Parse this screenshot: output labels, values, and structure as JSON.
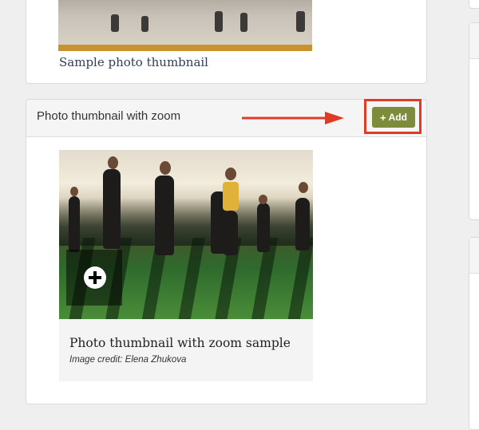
{
  "top_card": {
    "caption": "Sample photo thumbnail"
  },
  "main_card": {
    "title": "Photo thumbnail with zoom",
    "add_button": {
      "icon": "plus-icon",
      "label": "Add"
    },
    "annotation_color": "#e03b24",
    "accent_button_color": "#7d8c3a",
    "photo": {
      "zoom_icon": "zoom-plus-icon"
    },
    "caption": {
      "title": "Photo thumbnail with zoom sample",
      "credit": "Image credit: Elena Zhukova"
    }
  }
}
